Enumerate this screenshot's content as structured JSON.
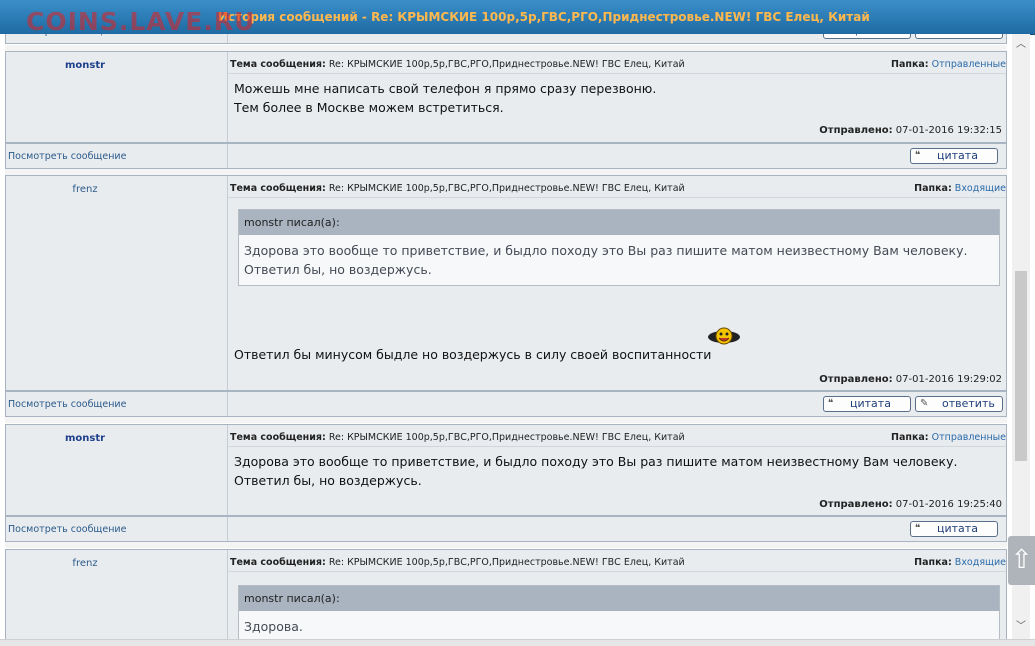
{
  "window": {
    "title": "История сообщений - Re: КРЫМСКИЕ 100р,5р,ГВС,РГО,Приднестровье.NEW! ГВС Елец, Китай"
  },
  "watermark": "COINS.LAVE.RU",
  "labels": {
    "subject": "Тема сообщения:",
    "folder": "Папка:",
    "sent": "Отправлено:",
    "view_message": "Посмотреть сообщение",
    "quote_button": "цитата",
    "reply_button": "ответить"
  },
  "messages": [
    {
      "author": "monstr",
      "subject": "Re: КРЫМСКИЕ 100р,5р,ГВС,РГО,Приднестровье.NEW! ГВС Елец, Китай",
      "folder": "Отправленные",
      "body_lines": [
        "Можешь мне написать свой телефон я прямо сразу перезвоню.",
        "Тем более в Москве можем встретиться."
      ],
      "sent": "07-01-2016 19:32:15"
    },
    {
      "author": "frenz",
      "subject": "Re: КРЫМСКИЕ 100р,5р,ГВС,РГО,Приднестровье.NEW! ГВС Елец, Китай",
      "folder": "Входящие",
      "quote_header": "monstr писал(а):",
      "quote_text": "Здорова это вообще то приветствие, и быдло походу это Вы раз пишите матом неизвестному Вам человеку. Ответил бы, но воздержусь.",
      "body": "Ответил бы минусом быдле но воздержусь в силу своей воспитанности",
      "sent": "07-01-2016 19:29:02"
    },
    {
      "author": "monstr",
      "subject": "Re: КРЫМСКИЕ 100р,5р,ГВС,РГО,Приднестровье.NEW! ГВС Елец, Китай",
      "folder": "Отправленные",
      "body": "Здорова это вообще то приветствие, и быдло походу это Вы раз пишите матом неизвестному Вам человеку. Ответил бы, но воздержусь.",
      "sent": "07-01-2016 19:25:40"
    },
    {
      "author": "frenz",
      "subject": "Re: КРЫМСКИЕ 100р,5р,ГВС,РГО,Приднестровье.NEW! ГВС Елец, Китай",
      "folder": "Входящие",
      "quote_header": "monstr писал(а):",
      "quote_text": "Здорова."
    }
  ]
}
